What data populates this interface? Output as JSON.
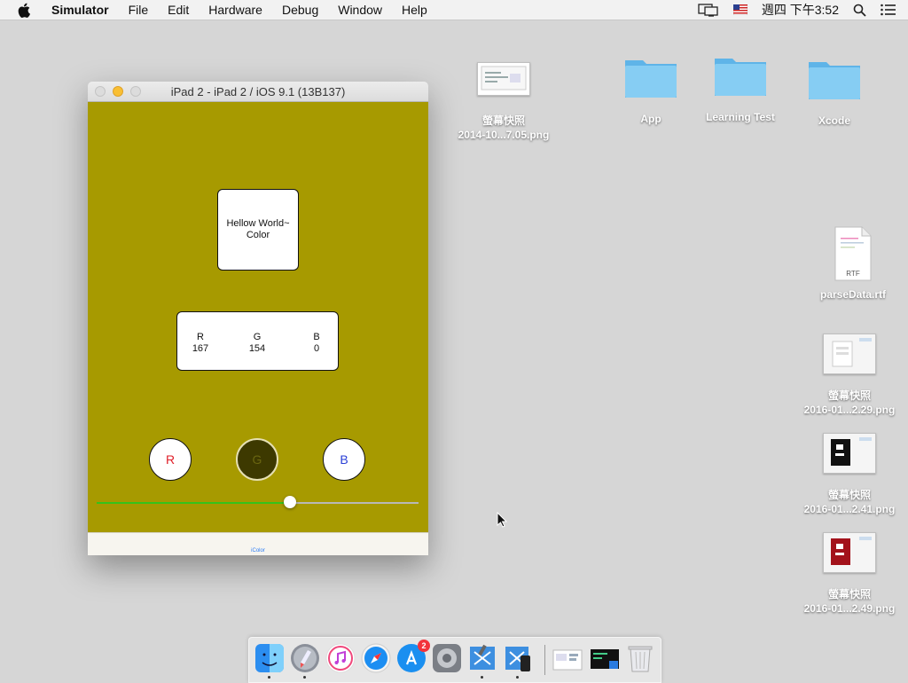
{
  "menubar": {
    "app_name": "Simulator",
    "items": [
      "File",
      "Edit",
      "Hardware",
      "Debug",
      "Window",
      "Help"
    ],
    "clock": "週四 下午3:52"
  },
  "desktop_icons": {
    "screenshot_top_label1": "螢幕快照",
    "screenshot_top_label2": "2014-10...7.05.png",
    "folder_app": "App",
    "folder_learning": "Learning Test",
    "folder_xcode": "Xcode",
    "rtf_label": "parseData.rtf",
    "rtf_badge": "RTF",
    "snap1_label1": "螢幕快照",
    "snap1_label2": "2016-01...2.29.png",
    "snap2_label1": "螢幕快照",
    "snap2_label2": "2016-01...2.41.png",
    "snap3_label1": "螢幕快照",
    "snap3_label2": "2016-01...2.49.png"
  },
  "simulator": {
    "window_title": "iPad 2 - iPad 2 / iOS 9.1 (13B137)",
    "background_color": "#a79a00",
    "hello_line1": "Hellow World~",
    "hello_line2": "Color",
    "rgb": {
      "r_label": "R",
      "r_value": "167",
      "g_label": "G",
      "g_value": "154",
      "b_label": "B",
      "b_value": "0"
    },
    "buttons": {
      "r": "R",
      "g": "G",
      "b": "B"
    },
    "slider_fraction": 0.6,
    "tab_label": "iColor"
  },
  "dock": {
    "apps": [
      "finder-icon",
      "launchpad-icon",
      "itunes-icon",
      "safari-icon",
      "app-store-icon",
      "system-preferences-icon",
      "xcode-icon",
      "simulator-icon"
    ],
    "app_store_badge": "2"
  },
  "colors": {
    "accent_blue": "#2b7cf5",
    "folder_blue": "#7fc6f0",
    "slider_green": "#36c21a"
  }
}
